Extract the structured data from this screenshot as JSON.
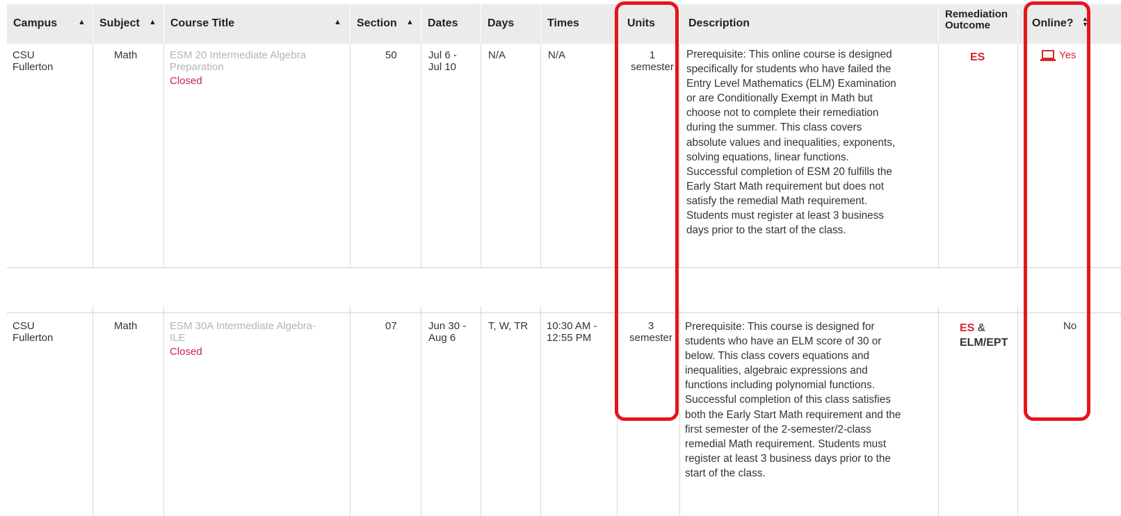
{
  "headers": {
    "campus": "Campus",
    "subject": "Subject",
    "course_title": "Course Title",
    "section": "Section",
    "dates": "Dates",
    "days": "Days",
    "times": "Times",
    "units": "Units",
    "description": "Description",
    "remediation_1": "Remediation",
    "remediation_2": "Outcome",
    "online": "Online?"
  },
  "icons": {
    "sort_asc": "sort-ascending-icon",
    "sort_both": "sort-both-icon",
    "online": "laptop-icon"
  },
  "colors": {
    "closed": "#c8254a",
    "es": "#d6252c",
    "highlight": "#e8141b",
    "header_bg": "#ebebeb"
  },
  "rows": [
    {
      "campus_1": "CSU",
      "campus_2": "Fullerton",
      "subject": "Math",
      "title_1": "ESM 20 Intermediate Algebra",
      "title_2": "Preparation",
      "status": "Closed",
      "section": "50",
      "dates_1": "Jul 6 -",
      "dates_2": "Jul 10",
      "days": "N/A",
      "times": "N/A",
      "units_1": "1",
      "units_2": "semester",
      "description": [
        "Prerequisite: This online course is designed",
        "specifically for students who have failed the",
        "Entry Level Mathematics (ELM) Examination",
        "or are Conditionally Exempt in Math but",
        "choose not to complete their remediation",
        "during the summer. This class covers",
        "absolute values and inequalities, exponents,",
        "solving equations, linear functions.",
        "Successful completion of ESM 20 fulfills the",
        "Early Start Math requirement but does not",
        "satisfy the remedial Math requirement.",
        "Students must register at least 3 business",
        "days prior to the start of the class."
      ],
      "remediation": "ES",
      "online": "Yes"
    },
    {
      "campus_1": "CSU",
      "campus_2": "Fullerton",
      "subject": "Math",
      "title_1": "ESM 30A Intermediate Algebra-",
      "title_2": "ILE",
      "status": "Closed",
      "section": "07",
      "dates_1": "Jun 30 -",
      "dates_2": "Aug 6",
      "days": "T, W, TR",
      "times_1": "10:30 AM -",
      "times_2": "12:55 PM",
      "units_1": "3",
      "units_2": "semester",
      "description": [
        "Prerequisite: This course is designed for",
        "students who have an ELM score of 30 or",
        "below. This class covers equations and",
        "inequalities, algebraic expressions and",
        "functions including polynomial functions.",
        "Successful completion of this class satisfies",
        "both the Early Start Math requirement and the",
        "first semester of the 2-semester/2-class",
        "remedial Math requirement. Students must",
        "register at least 3 business days prior to the",
        "start of the class."
      ],
      "remediation_es": "ES",
      "remediation_amp": "&",
      "remediation_ept": "ELM/EPT",
      "online": "No"
    }
  ]
}
